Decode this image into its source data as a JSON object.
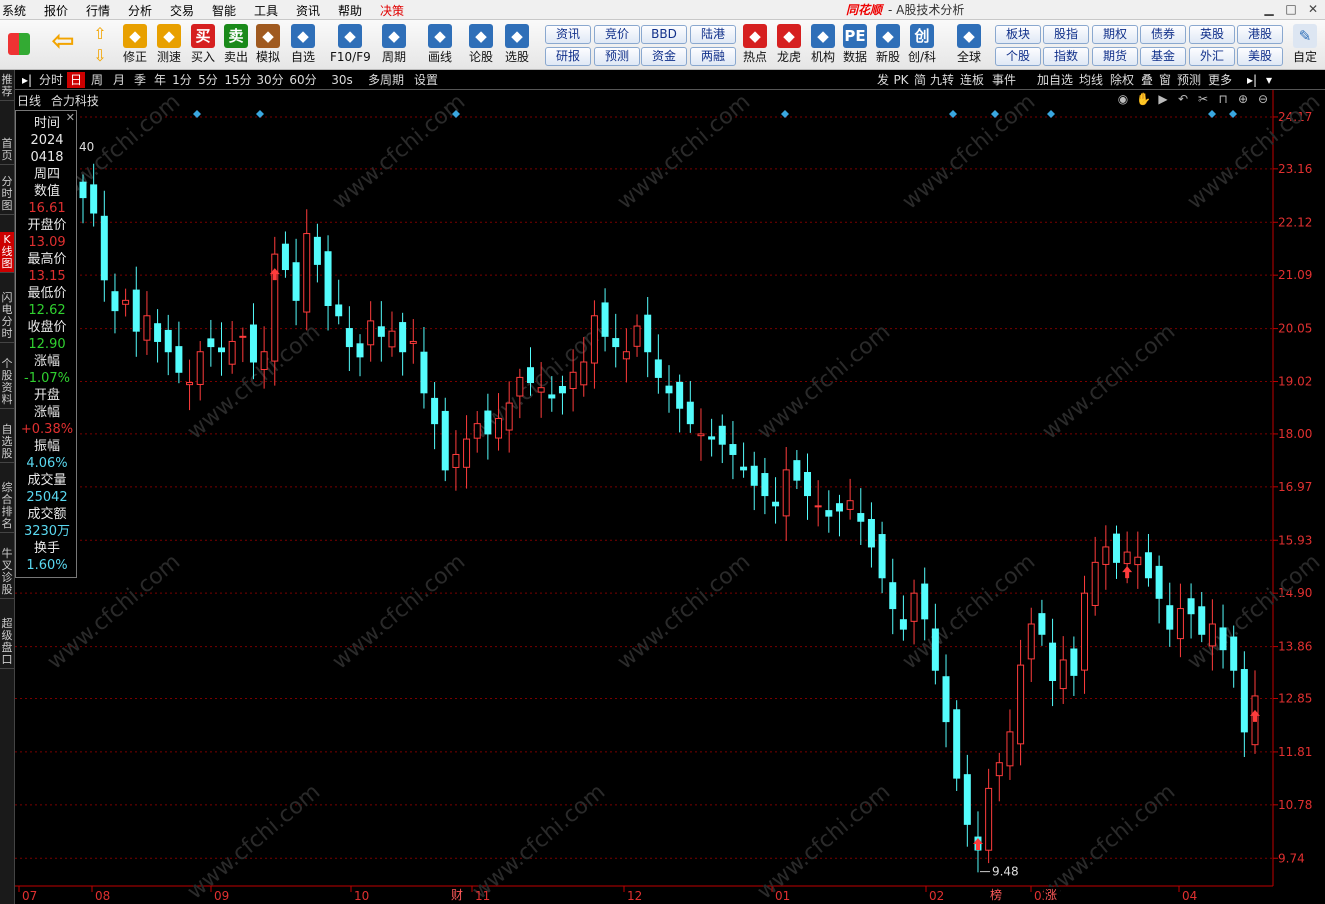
{
  "menu": [
    "系统",
    "报价",
    "行情",
    "分析",
    "交易",
    "智能",
    "工具",
    "资讯",
    "帮助",
    "决策"
  ],
  "app": {
    "logo": "同花顺",
    "title": "- A股技术分析"
  },
  "toolbar": {
    "buttons": [
      {
        "label": "修正",
        "icon": "up-down-arrows-icon",
        "color": "#e8a000"
      },
      {
        "label": "测速",
        "icon": "speed-icon",
        "color": "#e8a000"
      },
      {
        "label": "买入",
        "icon": "buy-icon",
        "glyph": "买",
        "color": "#d62020"
      },
      {
        "label": "卖出",
        "icon": "sell-icon",
        "glyph": "卖",
        "color": "#1a8a1a"
      },
      {
        "label": "模拟",
        "icon": "gavel-icon",
        "color": "#a05a20"
      },
      {
        "label": "自选",
        "icon": "star-icon",
        "color": "#2f6fb8"
      },
      {
        "label": "F10/F9",
        "icon": "f10-icon",
        "color": "#2f6fb8"
      },
      {
        "label": "周期",
        "icon": "clock-icon",
        "color": "#2f6fb8"
      },
      {
        "label": "画线",
        "icon": "pencil-icon",
        "color": "#2f6fb8"
      },
      {
        "label": "论股",
        "icon": "discuss-icon",
        "color": "#2f6fb8"
      },
      {
        "label": "选股",
        "icon": "select-icon",
        "color": "#2f6fb8"
      }
    ],
    "pills": [
      [
        "资讯",
        "研报"
      ],
      [
        "竞价",
        "预测"
      ],
      [
        "BBD",
        "资金"
      ],
      [
        "陆港",
        "两融"
      ]
    ],
    "buttons2": [
      {
        "label": "热点",
        "icon": "hot-icon",
        "color": "#d62020"
      },
      {
        "label": "龙虎",
        "icon": "dragon-icon",
        "color": "#d62020"
      },
      {
        "label": "机构",
        "icon": "bank-icon",
        "color": "#2f6fb8"
      },
      {
        "label": "数据",
        "icon": "pe-icon",
        "glyph": "PE",
        "color": "#2f6fb8"
      },
      {
        "label": "新股",
        "icon": "newstock-icon",
        "color": "#2f6fb8"
      },
      {
        "label": "创/科",
        "icon": "star-market-icon",
        "glyph": "创",
        "color": "#2f6fb8"
      },
      {
        "label": "全球",
        "icon": "globe-icon",
        "color": "#2f6fb8"
      }
    ],
    "pills2": [
      [
        "板块",
        "个股"
      ],
      [
        "股指",
        "指数"
      ],
      [
        "期权",
        "期货"
      ],
      [
        "债券",
        "基金"
      ],
      [
        "英股",
        "外汇"
      ],
      [
        "港股",
        "美股"
      ]
    ],
    "last": {
      "label": "自定",
      "icon": "custom-icon"
    }
  },
  "period_tabs": [
    "分时",
    "日",
    "周",
    "月",
    "季",
    "年",
    "1分",
    "5分",
    "15分",
    "30分",
    "60分",
    "30s",
    "多周期",
    "设置"
  ],
  "right_tabs": [
    "发",
    "PK",
    "简",
    "九转",
    "连板",
    "事件",
    "加自选",
    "均线",
    "除权",
    "叠",
    "窗",
    "预测",
    "更多"
  ],
  "side_tabs": [
    "推荐",
    "首页",
    "分时图",
    "K线图",
    "闪电分时",
    "个股资料",
    "自选股",
    "综合排名",
    "牛叉诊股",
    "超级盘口"
  ],
  "stock": {
    "period": "日线",
    "name": "合力科技"
  },
  "info_panel": [
    {
      "label": "时间",
      "value": "2024",
      "color": "#e8e8e8"
    },
    {
      "label": "",
      "value": "0418",
      "color": "#e8e8e8"
    },
    {
      "label": "",
      "value": "周四",
      "color": "#e8e8e8"
    },
    {
      "label": "数值",
      "value": "16.61",
      "color": "#e03030"
    },
    {
      "label": "开盘价",
      "value": "13.09",
      "color": "#e03030"
    },
    {
      "label": "最高价",
      "value": "13.15",
      "color": "#e03030"
    },
    {
      "label": "最低价",
      "value": "12.62",
      "color": "#30d030"
    },
    {
      "label": "收盘价",
      "value": "12.90",
      "color": "#30d030"
    },
    {
      "label": "涨幅",
      "value": "-1.07%",
      "color": "#30d030"
    },
    {
      "label": "开盘涨幅",
      "value": "+0.38%",
      "color": "#e03030"
    },
    {
      "label": "振幅",
      "value": "4.06%",
      "color": "#5ad8f0"
    },
    {
      "label": "成交量",
      "value": "25042",
      "color": "#5ad8f0"
    },
    {
      "label": "成交额",
      "value": "3230万",
      "color": "#5ad8f0"
    },
    {
      "label": "换手",
      "value": "1.60%",
      "color": "#5ad8f0"
    }
  ],
  "period_label": "40",
  "chart_data": {
    "type": "candlestick",
    "ylim": [
      9.2,
      24.5
    ],
    "y_ticks": [
      "24.17",
      "23.16",
      "22.12",
      "21.09",
      "20.05",
      "19.02",
      "18.00",
      "16.97",
      "15.93",
      "14.90",
      "13.86",
      "12.85",
      "11.81",
      "10.78",
      "9.74"
    ],
    "x_month_labels": [
      "07",
      "08",
      "09",
      "10",
      "11",
      "12",
      "01",
      "02",
      "03",
      "04"
    ],
    "event_markers": [
      "财",
      "榜",
      "涨"
    ],
    "min_label": "9.48",
    "up_color": "#ff3c3c",
    "down_color": "#54fcfc"
  },
  "colors": {
    "up": "#ff3c3c",
    "down": "#54fcfc",
    "grid": "#7a0000",
    "axis": "#c00000"
  }
}
